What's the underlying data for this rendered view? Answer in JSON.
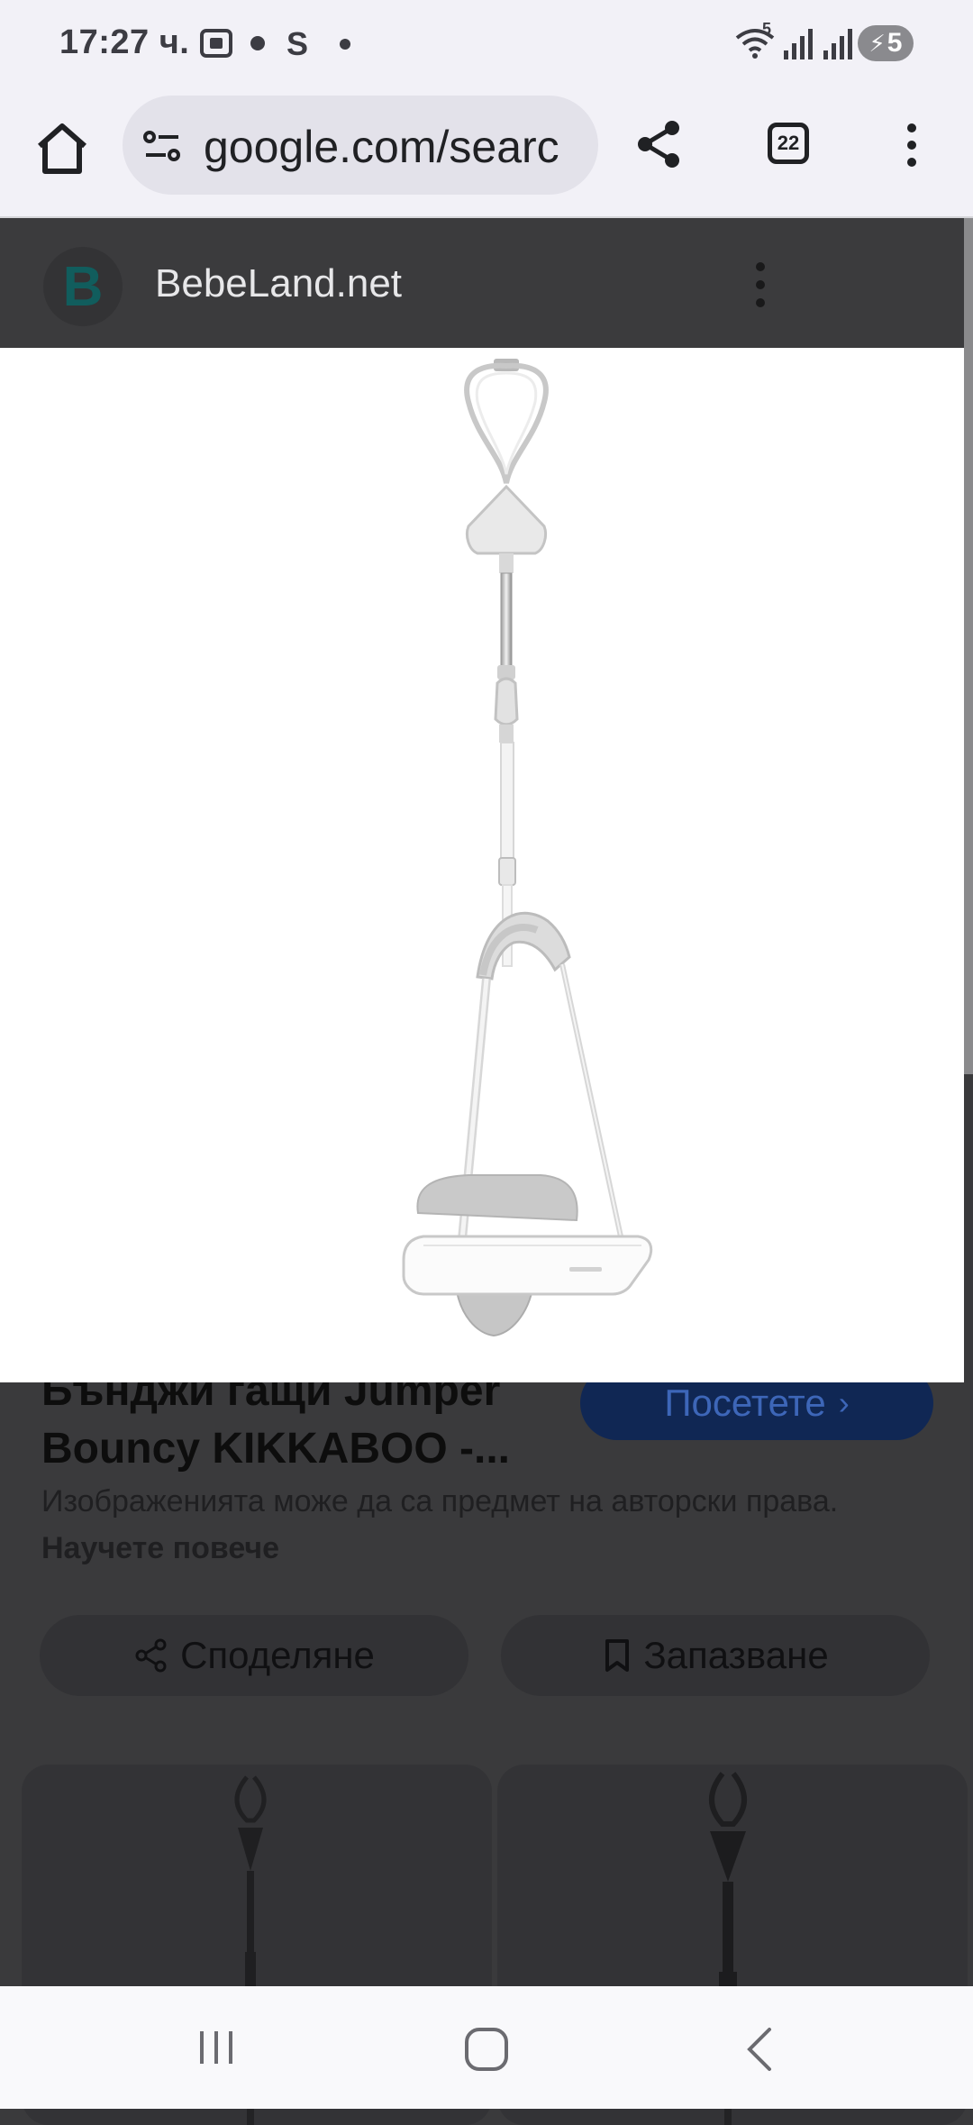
{
  "status_bar": {
    "time": "17:27 ч.",
    "carrier_glyph": "S",
    "wifi_superscript": "5",
    "battery_level": "5"
  },
  "toolbar": {
    "url": "google.com/searc",
    "tab_count": "22"
  },
  "source": {
    "logo_letter": "B",
    "name": "BebeLand.net"
  },
  "result": {
    "title_line1": "Бънджи гащи Jumper",
    "title_line2": "Bouncy KIKKABOO -...",
    "visit_label": "Посетете",
    "notice_text": "Изображенията може да са предмет на авторски права. ",
    "notice_link": "Научете повече",
    "share_label": "Споделяне",
    "save_label": "Запазване"
  },
  "colors": {
    "accent_blue": "#1a73e8",
    "overlay_dim": "#3a3a3c",
    "logo_teal": "#115d5d"
  }
}
